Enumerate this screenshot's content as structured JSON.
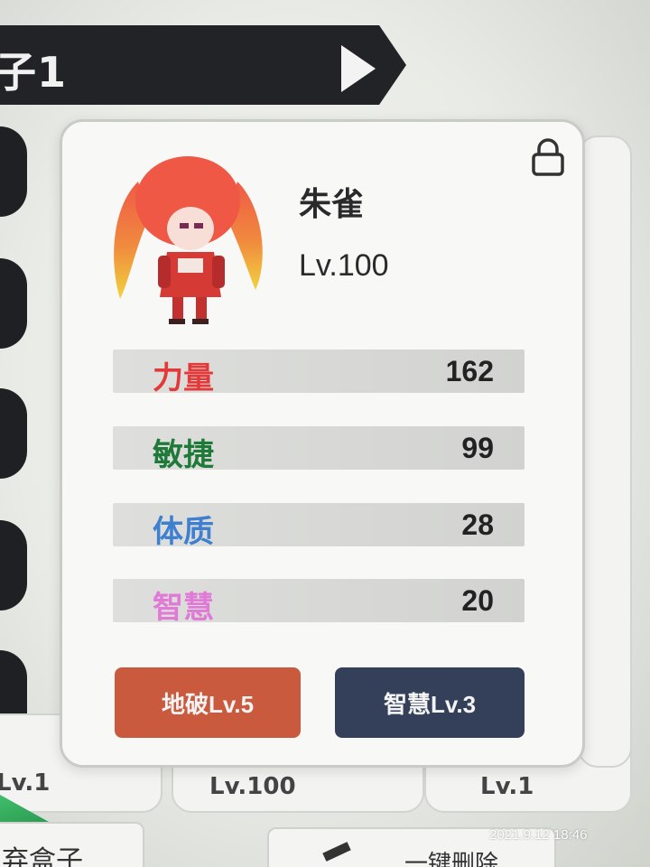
{
  "header": {
    "title": "子1"
  },
  "card": {
    "name": "朱雀",
    "level": "Lv.100",
    "stats": [
      {
        "label": "力量",
        "value": "162",
        "color": "#e23a3a"
      },
      {
        "label": "敏捷",
        "value": "99",
        "color": "#1f7a3a"
      },
      {
        "label": "体质",
        "value": "28",
        "color": "#3f7fd0"
      },
      {
        "label": "智慧",
        "value": "20",
        "color": "#e07ad6"
      }
    ],
    "buttons": {
      "left": "地破Lv.5",
      "right": "智慧Lv.3"
    }
  },
  "background": {
    "card_left_level": "Lv.1",
    "card_mid_level": "Lv.100",
    "card_right_level": "Lv.1",
    "bottom_left_label": "弃盒子",
    "bottom_right_label": "一键删除"
  },
  "status": {
    "timestamp": "2021.9.12 18:46"
  },
  "colors": {
    "header_bg": "#222326",
    "button_red": "#c95a3e",
    "button_blue": "#34405a"
  }
}
